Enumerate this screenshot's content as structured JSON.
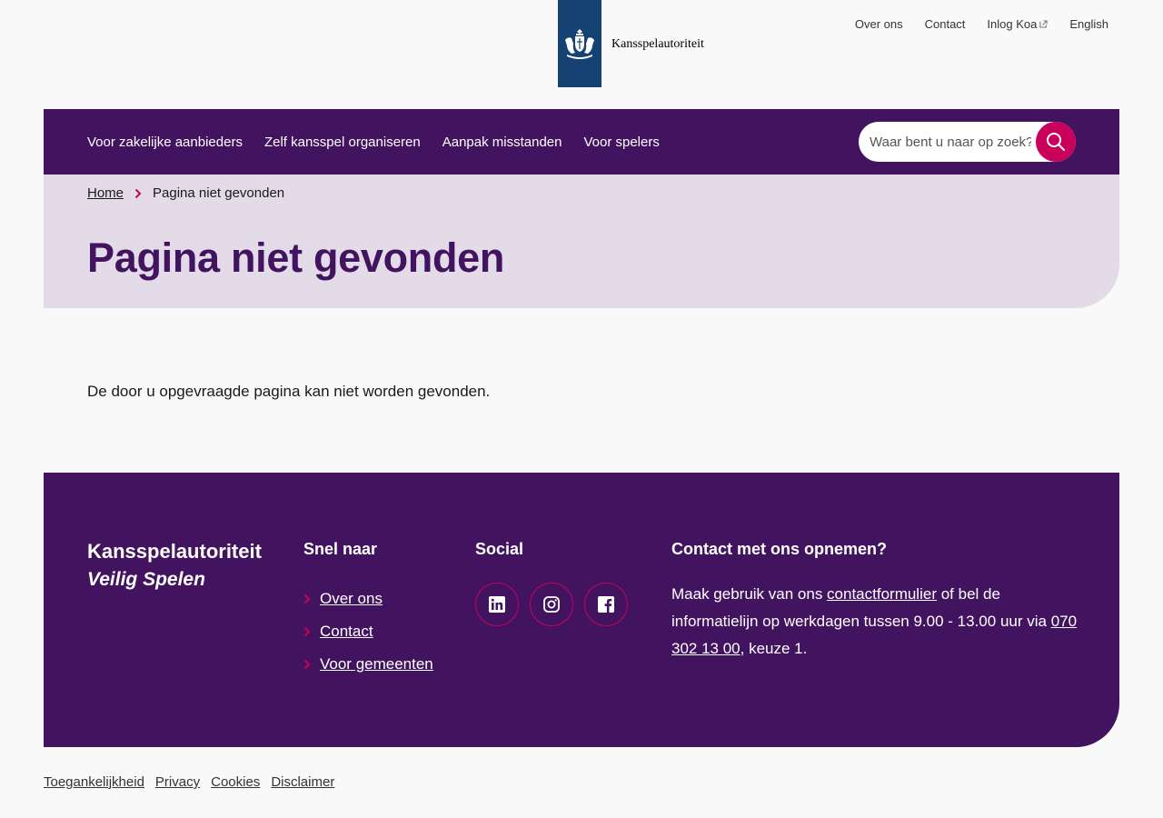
{
  "header": {
    "logo_text": "Kansspelautoriteit",
    "utility_nav": [
      "Over ons",
      "Contact",
      "Inlog Koa",
      "English"
    ]
  },
  "nav": {
    "items": [
      "Voor zakelijke aanbieders",
      "Zelf kansspel organiseren",
      "Aanpak misstanden",
      "Voor spelers"
    ],
    "search_placeholder": "Waar bent u naar op zoek?"
  },
  "breadcrumb": {
    "home": "Home",
    "current": "Pagina niet gevonden"
  },
  "page": {
    "title": "Pagina niet gevonden",
    "message": "De door u opgevraagde pagina kan niet worden gevonden."
  },
  "footer": {
    "brand_name": "Kansspelautoriteit",
    "brand_tagline": "Veilig Spelen",
    "snel_title": "Snel naar",
    "snel_links": [
      "Over ons",
      "Contact",
      "Voor gemeenten"
    ],
    "social_title": "Social",
    "social_icons": [
      "linkedin-icon",
      "instagram-icon",
      "facebook-icon"
    ],
    "contact_title": "Contact met ons opnemen?",
    "contact_pre": "Maak gebruik van ons ",
    "contact_link": "contactformulier",
    "contact_mid": " of bel de informatielijn op werkdagen tussen 9.00 - 13.00 uur via ",
    "contact_phone": "070 302 13 00",
    "contact_post": ", keuze 1."
  },
  "bottom_links": [
    "Toegankelijkheid",
    "Privacy",
    "Cookies",
    "Disclaimer"
  ],
  "colors": {
    "brand_purple": "#42145f",
    "accent_pink": "#ca005d",
    "hero_bg": "#e3dbe8",
    "logo_blue": "#154273"
  }
}
